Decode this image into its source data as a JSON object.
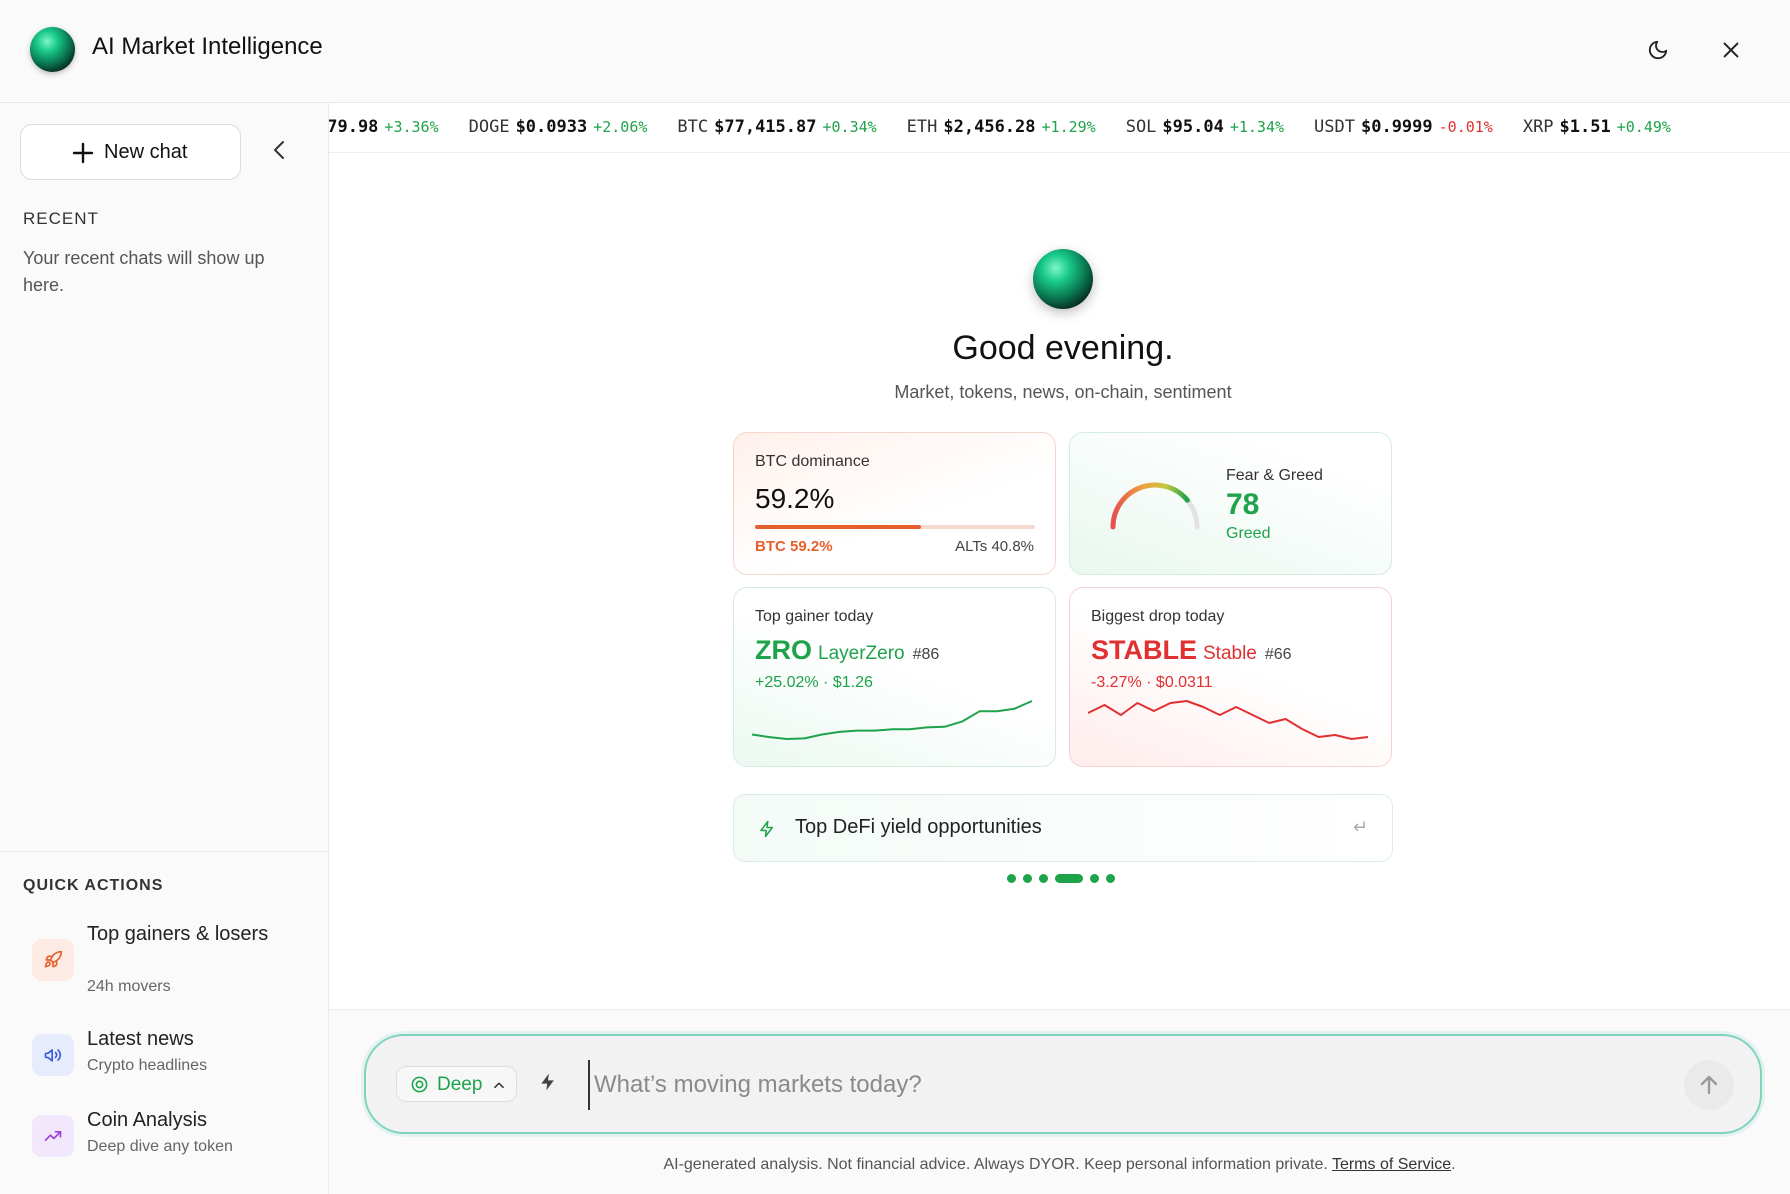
{
  "header": {
    "title": "AI Market Intelligence",
    "theme_icon": "moon-icon",
    "close_icon": "close-icon"
  },
  "sidebar": {
    "new_chat_label": "New chat",
    "recent_heading": "RECENT",
    "recent_empty": "Your recent chats will show up here.",
    "quick_actions_heading": "QUICK ACTIONS",
    "quick_actions": [
      {
        "title": "Top gainers & losers",
        "subtitle": "24h movers",
        "icon": "rocket-icon",
        "color": "#e6602d"
      },
      {
        "title": "Latest news",
        "subtitle": "Crypto headlines",
        "icon": "megaphone-icon",
        "color": "#3b5bdb"
      },
      {
        "title": "Coin Analysis",
        "subtitle": "Deep dive any token",
        "icon": "trending-up-icon",
        "color": "#9b3fd6"
      }
    ]
  },
  "ticker": [
    {
      "symbol": "",
      "price": "$79.98",
      "change": "+3.36%",
      "dir": "up"
    },
    {
      "symbol": "DOGE",
      "price": "$0.0933",
      "change": "+2.06%",
      "dir": "up"
    },
    {
      "symbol": "BTC",
      "price": "$77,415.87",
      "change": "+0.34%",
      "dir": "up"
    },
    {
      "symbol": "ETH",
      "price": "$2,456.28",
      "change": "+1.29%",
      "dir": "up"
    },
    {
      "symbol": "SOL",
      "price": "$95.04",
      "change": "+1.34%",
      "dir": "up"
    },
    {
      "symbol": "USDT",
      "price": "$0.9999",
      "change": "-0.01%",
      "dir": "down"
    },
    {
      "symbol": "XRP",
      "price": "$1.51",
      "change": "+0.49%",
      "dir": "up"
    }
  ],
  "main": {
    "greeting": "Good evening.",
    "subtitle": "Market, tokens, news, on-chain, sentiment"
  },
  "cards": {
    "dominance": {
      "label": "BTC dominance",
      "value": "59.2%",
      "btc_fraction": 0.592,
      "btc_label": "BTC 59.2%",
      "alts_label": "ALTs 40.8%"
    },
    "fear_greed": {
      "label": "Fear & Greed",
      "value": "78",
      "score": 78,
      "classification": "Greed"
    },
    "top_gainer": {
      "label": "Top gainer today",
      "symbol": "ZRO",
      "name": "LayerZero",
      "rank": "#86",
      "stat": "+25.02% · $1.26",
      "color": "#1ea34a",
      "sparkline": [
        1.02,
        1.0,
        0.985,
        0.99,
        1.02,
        1.04,
        1.05,
        1.05,
        1.06,
        1.06,
        1.075,
        1.08,
        1.12,
        1.2,
        1.2,
        1.22,
        1.28
      ]
    },
    "biggest_drop": {
      "label": "Biggest drop today",
      "symbol": "STABLE",
      "name": "Stable",
      "rank": "#66",
      "stat": "-3.27% · $0.0311",
      "color": "#e03030",
      "sparkline": [
        0.0318,
        0.0322,
        0.0317,
        0.0323,
        0.0319,
        0.0323,
        0.0324,
        0.0321,
        0.0317,
        0.0321,
        0.0317,
        0.0313,
        0.0315,
        0.031,
        0.0306,
        0.0307,
        0.0305,
        0.0306
      ]
    }
  },
  "suggestion": {
    "text": "Top DeFi yield opportunities",
    "icon": "bolt-icon",
    "enter_glyph": "↵"
  },
  "carousel": {
    "count": 6,
    "active": 3
  },
  "composer": {
    "mode_label": "Deep",
    "mode_icon": "target-icon",
    "placeholder": "What’s moving markets today?",
    "send_icon": "arrow-up-icon"
  },
  "footer": {
    "disclaimer": "AI-generated analysis. Not financial advice. Always DYOR. Keep personal information private.",
    "terms_label": "Terms of Service",
    "terms_suffix": "."
  }
}
